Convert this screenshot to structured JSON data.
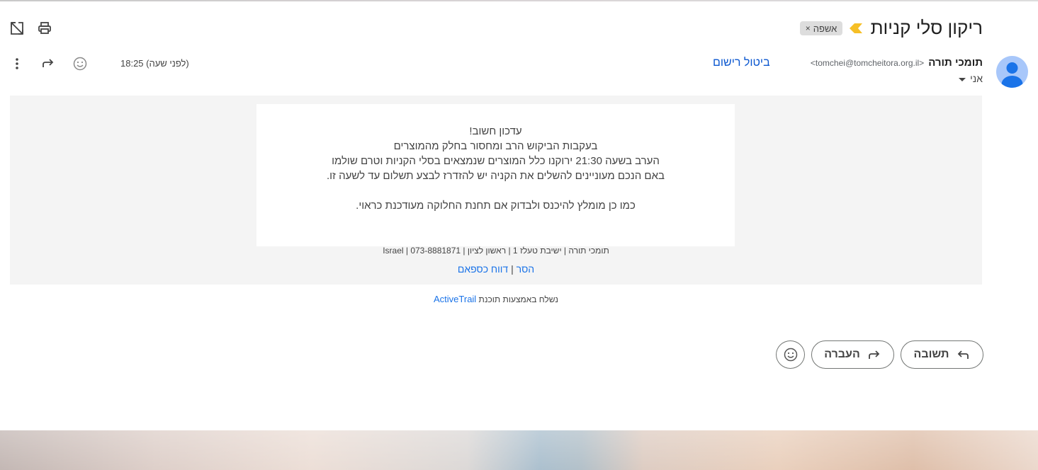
{
  "header": {
    "subject": "ריקון סלי קניות",
    "label": "אשפה",
    "label_remove": "×",
    "icons": [
      "open-new-window-icon",
      "print-icon",
      "important-marker-icon"
    ]
  },
  "sender": {
    "name": "תומכי תורה",
    "email": "<tomchei@tomcheitora.org.il>",
    "unsubscribe_label": "ביטול רישום",
    "to_label": "אני",
    "timestamp": "18:25 (לפני שעה)"
  },
  "email": {
    "lines": [
      "עדכון חשוב!",
      "בעקבות הביקוש הרב ומחסור בחלק מהמוצרים",
      "הערב בשעה 21:30 ירוקנו כלל המוצרים שנמצאים בסלי הקניות וטרם שולמו",
      "באם הנכם מעוניינים להשלים את הקניה יש להזדרז לבצע תשלום עד לשעה זו."
    ],
    "closing_line": "כמו כן מומלץ להיכנס ולבדוק אם תחנת החלוקה מעודכנת כראוי.",
    "footer_address": "תומכי תורה | ישיבת טעלז 1 | ראשון לציון | 073-8881871 | Israel",
    "footer_remove": "הסר",
    "footer_separator": "|",
    "footer_spam": "דווח כספאם",
    "sent_via_prefix": "נשלח באמצעות תוכנת",
    "sent_via_brand": "ActiveTrail"
  },
  "actions": {
    "reply_label": "תשובה",
    "forward_label": "העברה"
  },
  "colors": {
    "link": "#0b57d0",
    "avatar_bg": "#a8c7fa",
    "avatar_fg": "#1a73e8",
    "important": "#f6bf26",
    "body_bg": "#f4f4f4"
  }
}
